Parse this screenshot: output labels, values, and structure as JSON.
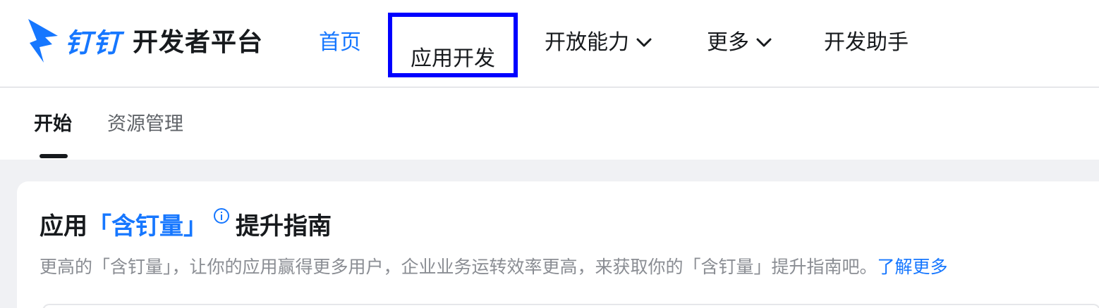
{
  "brand": {
    "name": "钉钉",
    "title": "开发者平台"
  },
  "nav": {
    "home": "首页",
    "app_dev": "应用开发",
    "open_capability": "开放能力",
    "more": "更多",
    "dev_assistant": "开发助手"
  },
  "subtabs": {
    "start": "开始",
    "resource_mgmt": "资源管理"
  },
  "card": {
    "title_prefix": "应用",
    "title_highlight": "「含钉量」",
    "title_suffix": "提升指南",
    "description": "更高的「含钉量」，让你的应用赢得更多用户，企业业务运转效率更高，来获取你的「含钉量」提升指南吧。",
    "link": "了解更多"
  },
  "colors": {
    "accent": "#1677ff",
    "highlight_box": "#0000ff"
  },
  "icons": {
    "logo": "dingtalk-logo-icon",
    "chevron": "chevron-down-icon",
    "info": "info-icon"
  }
}
